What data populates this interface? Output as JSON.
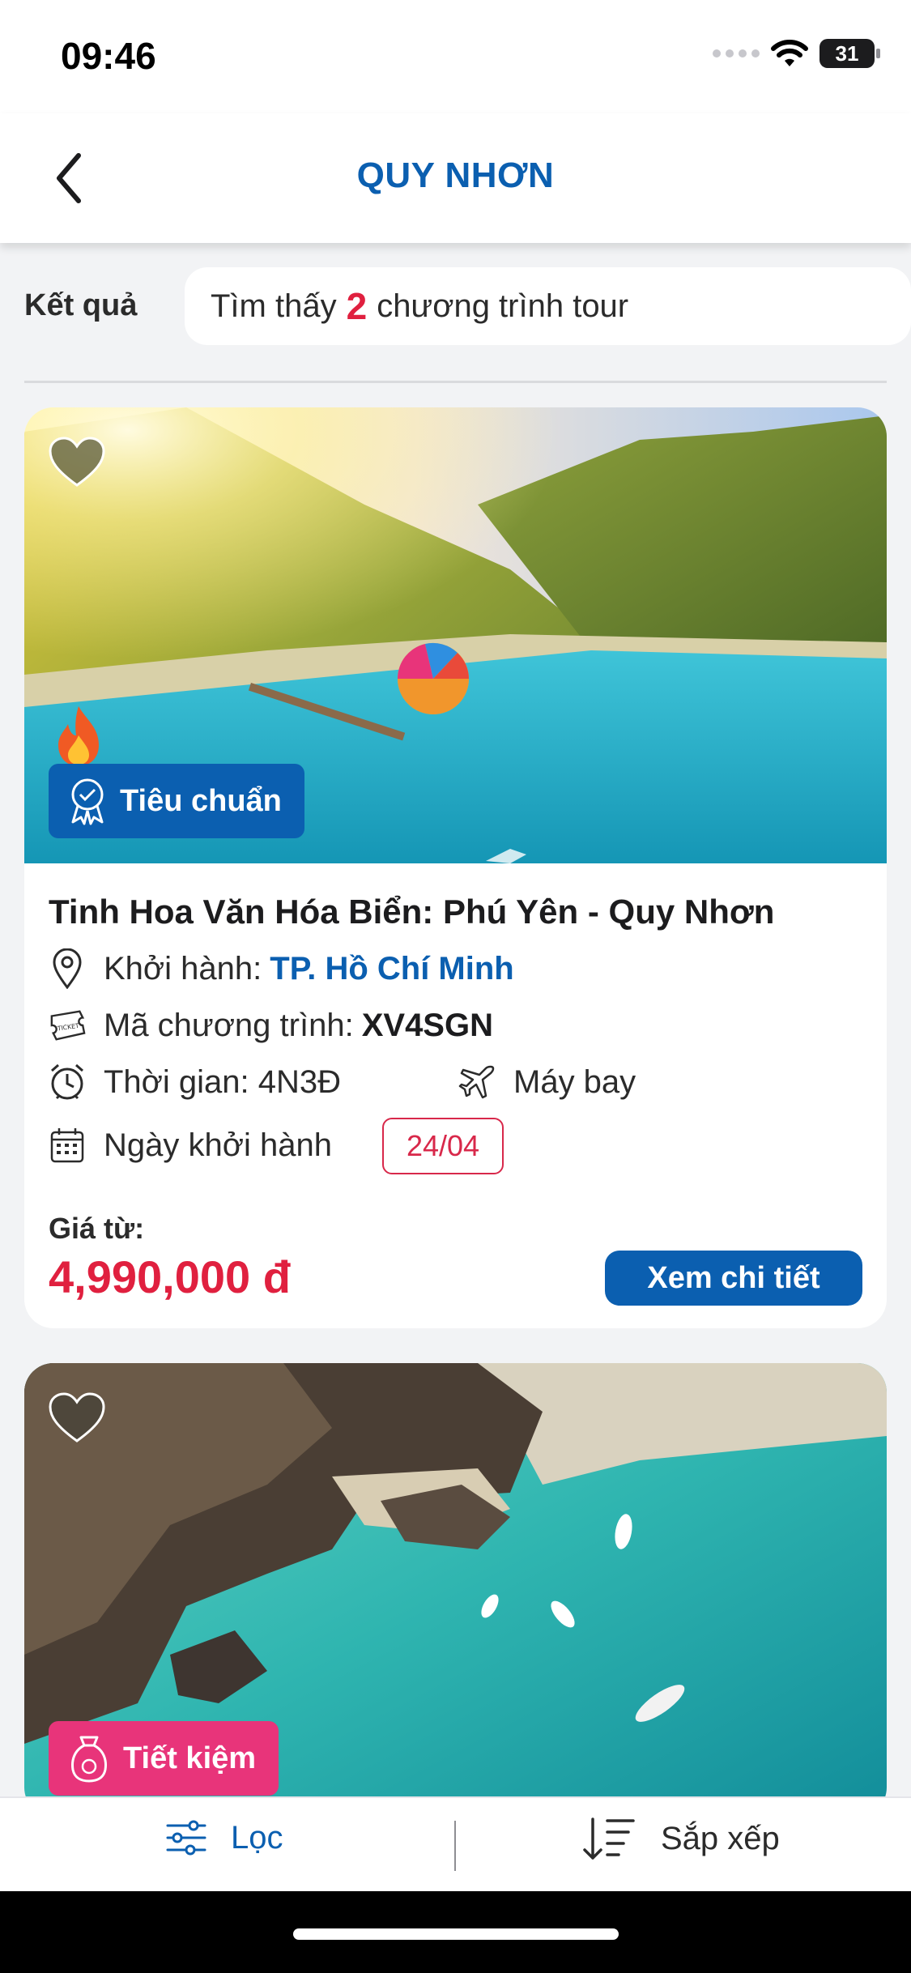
{
  "status_bar": {
    "time": "09:46",
    "battery": "31"
  },
  "header": {
    "title": "QUY NHƠN"
  },
  "results": {
    "label": "Kết quả",
    "prefix": "Tìm thấy",
    "count": "2",
    "suffix": "chương trình tour"
  },
  "tours": [
    {
      "tag": "Tiêu chuẩn",
      "title": "Tinh Hoa Văn Hóa Biển: Phú Yên - Quy Nhơn",
      "departure_label": "Khởi hành:",
      "departure_city": "TP. Hồ Chí Minh",
      "code_label": "Mã chương trình:",
      "code": "XV4SGN",
      "duration": "Thời gian: 4N3Đ",
      "transport": "Máy bay",
      "dates_label": "Ngày khởi hành",
      "date": "24/04",
      "price_label": "Giá từ:",
      "price": "4,990,000 đ",
      "detail_button": "Xem chi tiết"
    },
    {
      "tag": "Tiết kiệm"
    }
  ],
  "bottom_bar": {
    "filter_label": "Lọc",
    "sort_label": "Sắp xếp"
  },
  "colors": {
    "primary": "#0b5fb0",
    "accent_red": "#e0203f",
    "saving_pink": "#e8347a"
  },
  "icons": [
    "back-chevron-icon",
    "heart-icon",
    "fire-icon",
    "badge-icon",
    "location-pin-icon",
    "ticket-icon",
    "alarm-clock-icon",
    "airplane-icon",
    "calendar-icon",
    "piggy-bank-icon",
    "filter-sliders-icon",
    "sort-icon",
    "wifi-icon"
  ]
}
